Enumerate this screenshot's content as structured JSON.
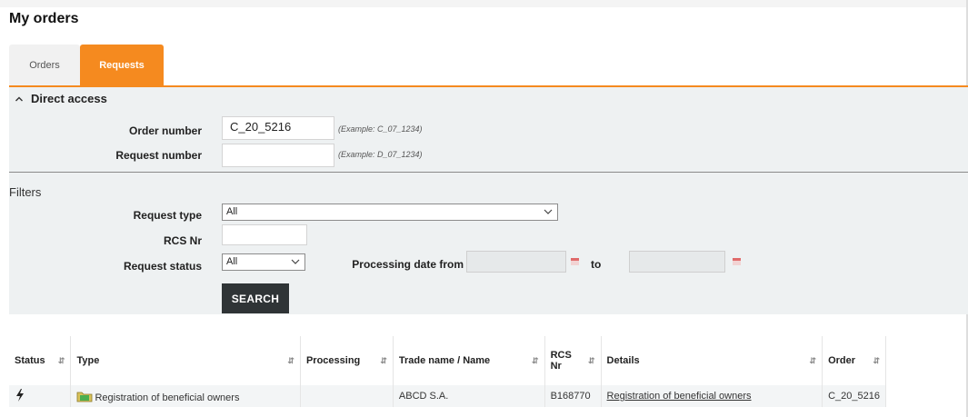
{
  "page": {
    "title": "My orders"
  },
  "tabs": [
    {
      "label": "Orders",
      "active": false
    },
    {
      "label": "Requests",
      "active": true
    }
  ],
  "direct_access": {
    "title": "Direct access",
    "order_number": {
      "label": "Order number",
      "value": "C_20_5216",
      "hint": "(Example: C_07_1234)"
    },
    "request_number": {
      "label": "Request number",
      "value": "",
      "hint": "(Example: D_07_1234)"
    }
  },
  "filters": {
    "title": "Filters",
    "request_type": {
      "label": "Request type",
      "selected": "All"
    },
    "rcs_nr": {
      "label": "RCS Nr",
      "value": ""
    },
    "request_status": {
      "label": "Request status",
      "selected": "All"
    },
    "processing_date": {
      "label_from": "Processing date from",
      "label_to": "to",
      "from": "",
      "to": ""
    },
    "search_label": "SEARCH"
  },
  "table": {
    "columns": [
      "Status",
      "Type",
      "Processing",
      "Trade name / Name",
      "RCS Nr",
      "Details",
      "Order"
    ],
    "rows": [
      {
        "status_icon": "bolt-icon",
        "type": "Registration of beneficial owners",
        "processing": "",
        "trade_name": "ABCD S.A.",
        "rcs_nr": "B168770",
        "details": "Registration of beneficial owners",
        "order": "C_20_5216"
      }
    ]
  },
  "colors": {
    "accent": "#f58a1f",
    "panel": "#eef1f2",
    "button": "#2f3436"
  }
}
